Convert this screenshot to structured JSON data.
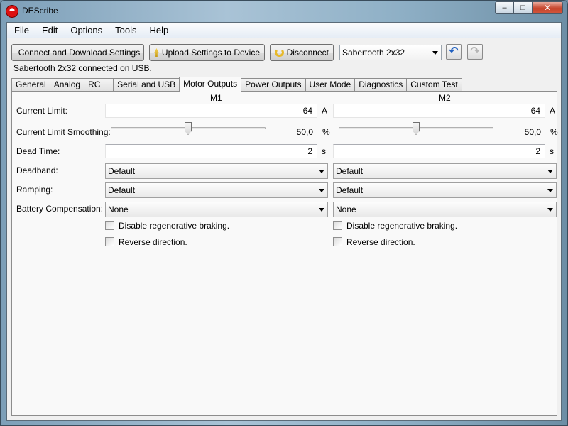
{
  "window": {
    "title": "DEScribe"
  },
  "menu": [
    "File",
    "Edit",
    "Options",
    "Tools",
    "Help"
  ],
  "toolbar": {
    "connect_label": "Connect and Download Settings",
    "upload_label": "Upload Settings to Device",
    "disconnect_label": "Disconnect",
    "device_select": "Sabertooth 2x32"
  },
  "status": "Sabertooth 2x32 connected on USB.",
  "tabs": [
    "General",
    "Analog",
    "RC",
    "Serial and USB",
    "Motor Outputs",
    "Power Outputs",
    "User Mode",
    "Diagnostics",
    "Custom Test"
  ],
  "active_tab": "Motor Outputs",
  "columns": {
    "m1": "M1",
    "m2": "M2"
  },
  "labels": {
    "current_limit": "Current Limit:",
    "smoothing": "Current Limit Smoothing:",
    "dead_time": "Dead Time:",
    "deadband": "Deadband:",
    "ramping": "Ramping:",
    "battery": "Battery Compensation:"
  },
  "m1": {
    "current_limit": "64",
    "current_unit": "A",
    "smoothing_value": "50,0",
    "smoothing_fraction": 0.5,
    "smoothing_unit": "%",
    "dead_time": "2",
    "dead_time_unit": "s",
    "deadband": "Default",
    "ramping": "Default",
    "battery": "None",
    "regen_label": "Disable regenerative braking.",
    "reverse_label": "Reverse direction."
  },
  "m2": {
    "current_limit": "64",
    "current_unit": "A",
    "smoothing_value": "50,0",
    "smoothing_fraction": 0.5,
    "smoothing_unit": "%",
    "dead_time": "2",
    "dead_time_unit": "s",
    "deadband": "Default",
    "ramping": "Default",
    "battery": "None",
    "regen_label": "Disable regenerative braking.",
    "reverse_label": "Reverse direction."
  }
}
